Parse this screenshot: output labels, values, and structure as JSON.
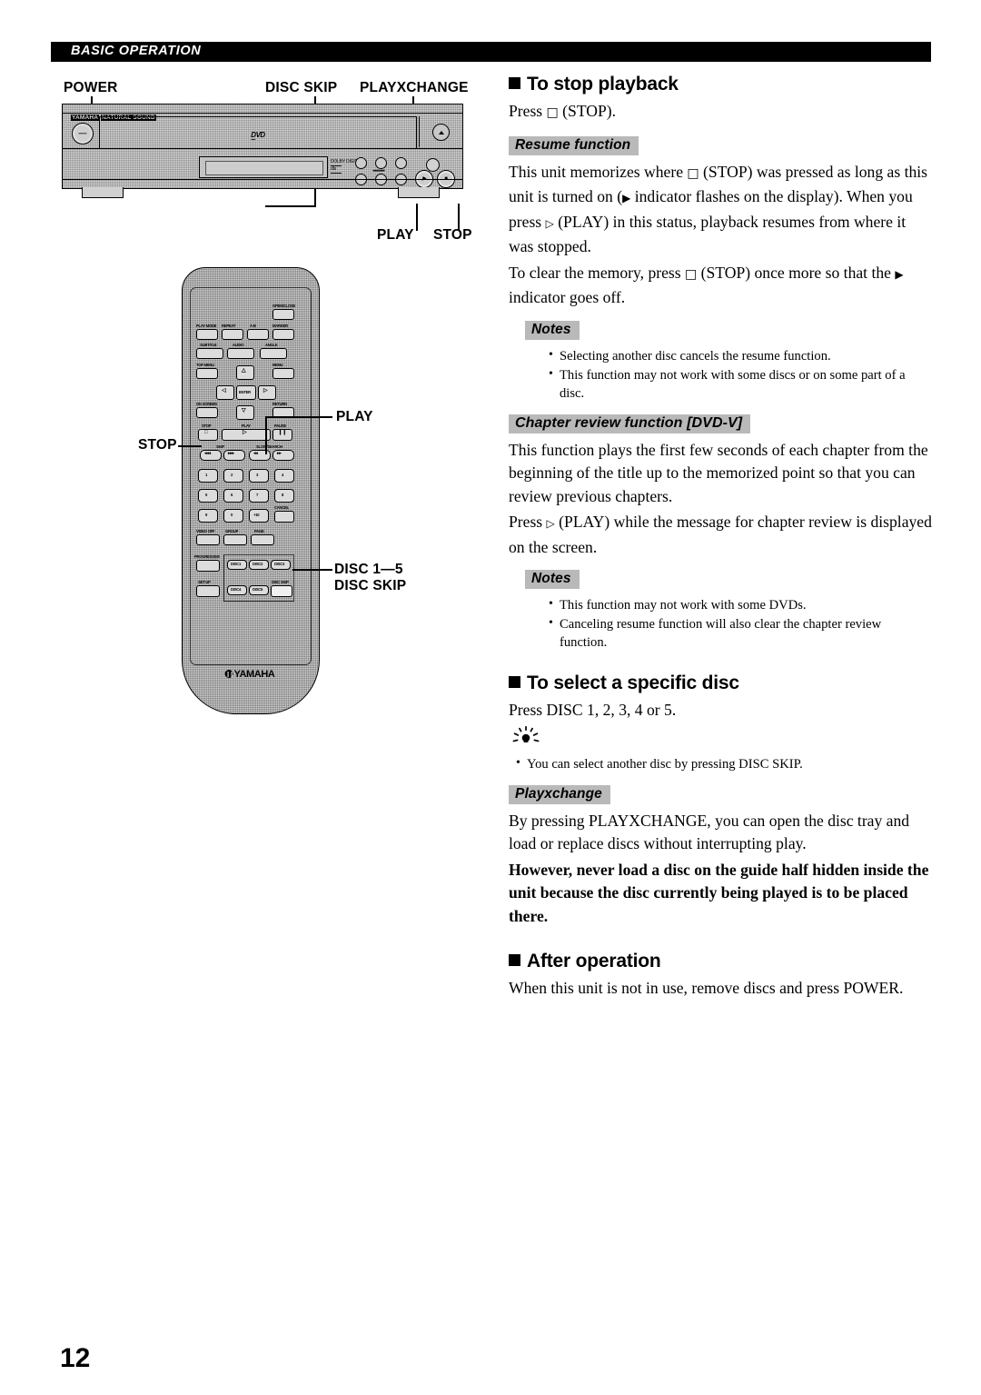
{
  "header": {
    "section_label": "BASIC OPERATION"
  },
  "page_number": "12",
  "figure_player": {
    "callouts": {
      "power": "POWER",
      "disc_skip": "DISC SKIP",
      "playxchange": "PLAYXCHANGE",
      "play": "PLAY",
      "stop": "STOP"
    },
    "brand": "YAMAHA",
    "brand_mark": "NATURAL SOUND",
    "disc_logo": "DVD",
    "front_marks": {
      "skip": "SKIP",
      "slow_search": "SLOW/SEARCH"
    },
    "display_marks": [
      "DOLBY DIGITAL",
      "dts"
    ]
  },
  "figure_remote": {
    "callouts": {
      "play": "PLAY",
      "stop": "STOP",
      "disc_range": "DISC 1—5",
      "disc_skip": "DISC SKIP"
    },
    "brand": "YAMAHA",
    "buttons": {
      "open_close": "OPEN/CLOSE",
      "play_mode": "PLAY MODE",
      "repeat": "REPEAT",
      "a_b": "A-B",
      "marker": "MARKER",
      "subtitle": "SUBTITLE",
      "audio": "AUDIO",
      "angle": "ANGLE",
      "top_menu": "TOP MENU",
      "menu": "MENU",
      "enter": "ENTER",
      "on_screen": "ON SCREEN",
      "return": "RETURN",
      "stop": "STOP",
      "play": "PLAY",
      "pause": "PAUSE",
      "skip": "SKIP",
      "slow_search": "SLOW/SEARCH",
      "cancel": "CANCEL",
      "video_off": "VIDEO OFF",
      "group": "GROUP",
      "page": "PAGE",
      "progressive": "PROGRESSIVE",
      "set_up": "SET UP",
      "disc_skip": "DISC SKIP",
      "numbers": [
        "1",
        "2",
        "3",
        "4",
        "5",
        "6",
        "7",
        "8",
        "9",
        "0",
        "+10"
      ],
      "discs": [
        "DISC1",
        "DISC2",
        "DISC3",
        "DISC4",
        "DISC5"
      ]
    }
  },
  "content": {
    "stop_playback": {
      "heading": "To stop playback",
      "press_line_a": "Press ",
      "press_glyph": "□",
      "press_line_b": " (STOP).",
      "resume": {
        "label": "Resume function",
        "para1_a": "This unit memorizes where ",
        "para1_g1": "□",
        "para1_b": " (STOP) was pressed as long as this unit is turned on (",
        "para1_g2": "▶",
        "para1_c": " indicator flashes on the display). When you press ",
        "para1_g3": "▷",
        "para1_d": " (PLAY) in this status, playback resumes from where it was stopped.",
        "para2_a": "To clear the memory, press ",
        "para2_g1": "□",
        "para2_b": " (STOP) once more so that the ",
        "para2_g2": "▶",
        "para2_c": " indicator goes off.",
        "notes_label": "Notes",
        "notes": [
          "Selecting another disc cancels the resume function.",
          "This function may not work with some discs or on some part of a disc."
        ]
      },
      "chapter_review": {
        "label": "Chapter review function [DVD-V]",
        "para1": "This function plays the first few seconds of each chapter from the beginning of the title up to the memorized point so that you can review previous chapters.",
        "para2_a": "Press ",
        "para2_g1": "▷",
        "para2_b": " (PLAY) while the message for chapter review is displayed on the screen.",
        "notes_label": "Notes",
        "notes": [
          "This function may not work with some DVDs.",
          "Canceling resume function will also clear the chapter review function."
        ]
      }
    },
    "select_disc": {
      "heading": "To select a specific disc",
      "para1": "Press DISC 1, 2, 3, 4 or 5.",
      "tip_icon": "lightbulb-tip-icon",
      "tip": "You can select another disc by pressing DISC SKIP.",
      "playxchange": {
        "label": "Playxchange",
        "para_normal": "By pressing PLAYXCHANGE, you can open the disc tray and load or replace discs without interrupting play.",
        "para_bold": "However, never load a disc on the guide half hidden inside the unit because the disc currently being played is to be placed there."
      }
    },
    "after_operation": {
      "heading": "After operation",
      "para1": "When this unit is not in use, remove discs and press POWER."
    }
  }
}
